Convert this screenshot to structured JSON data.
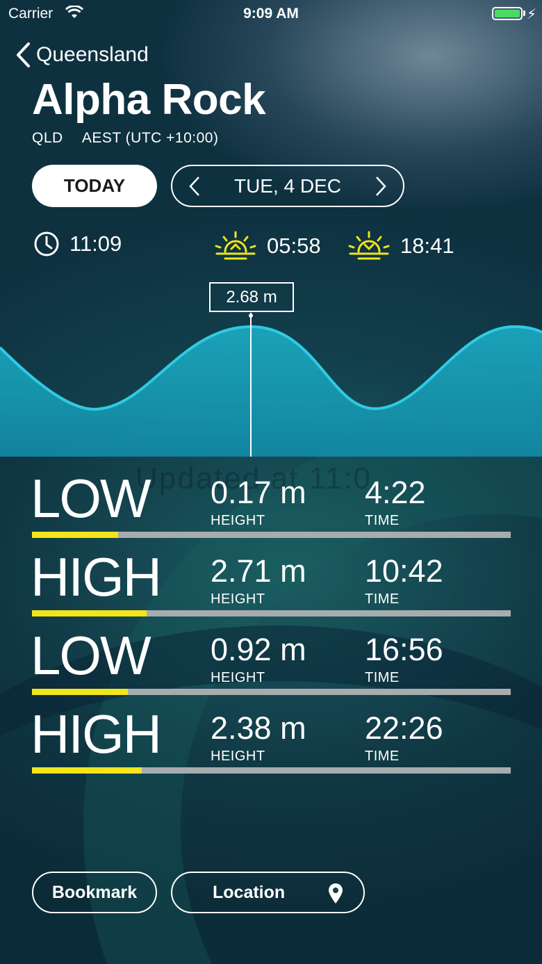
{
  "status_bar": {
    "carrier": "Carrier",
    "time": "9:09 AM",
    "battery_color": "#4cd964"
  },
  "nav": {
    "back_label": "Queensland"
  },
  "location": {
    "name": "Alpha Rock",
    "state": "QLD",
    "timezone": "AEST (UTC +10:00)"
  },
  "controls": {
    "today_label": "TODAY",
    "date_label": "TUE, 4 DEC"
  },
  "info": {
    "current_time": "11:09",
    "sunrise": "05:58",
    "sunset": "18:41"
  },
  "chart": {
    "marker_label": "2.68 m",
    "fill_color": "#1aa9c4",
    "line_color": "#28c6e0"
  },
  "ghost_text": "Updated at 11:0",
  "tides": [
    {
      "type": "LOW",
      "height": "0.17 m",
      "height_caption": "HEIGHT",
      "time": "4:22",
      "time_caption": "TIME",
      "level": 0.18
    },
    {
      "type": "HIGH",
      "height": "2.71 m",
      "height_caption": "HEIGHT",
      "time": "10:42",
      "time_caption": "TIME",
      "level": 0.24
    },
    {
      "type": "LOW",
      "height": "0.92 m",
      "height_caption": "HEIGHT",
      "time": "16:56",
      "time_caption": "TIME",
      "level": 0.2
    },
    {
      "type": "HIGH",
      "height": "2.38 m",
      "height_caption": "HEIGHT",
      "time": "22:26",
      "time_caption": "TIME",
      "level": 0.23
    }
  ],
  "accent_color": "#f2e51a",
  "buttons": {
    "bookmark_label": "Bookmark",
    "location_label": "Location"
  },
  "icons": {
    "back": "chevron-left-icon",
    "clock": "clock-icon",
    "sunrise": "sunrise-icon",
    "sunset": "sunset-icon",
    "pin": "location-pin-icon"
  }
}
